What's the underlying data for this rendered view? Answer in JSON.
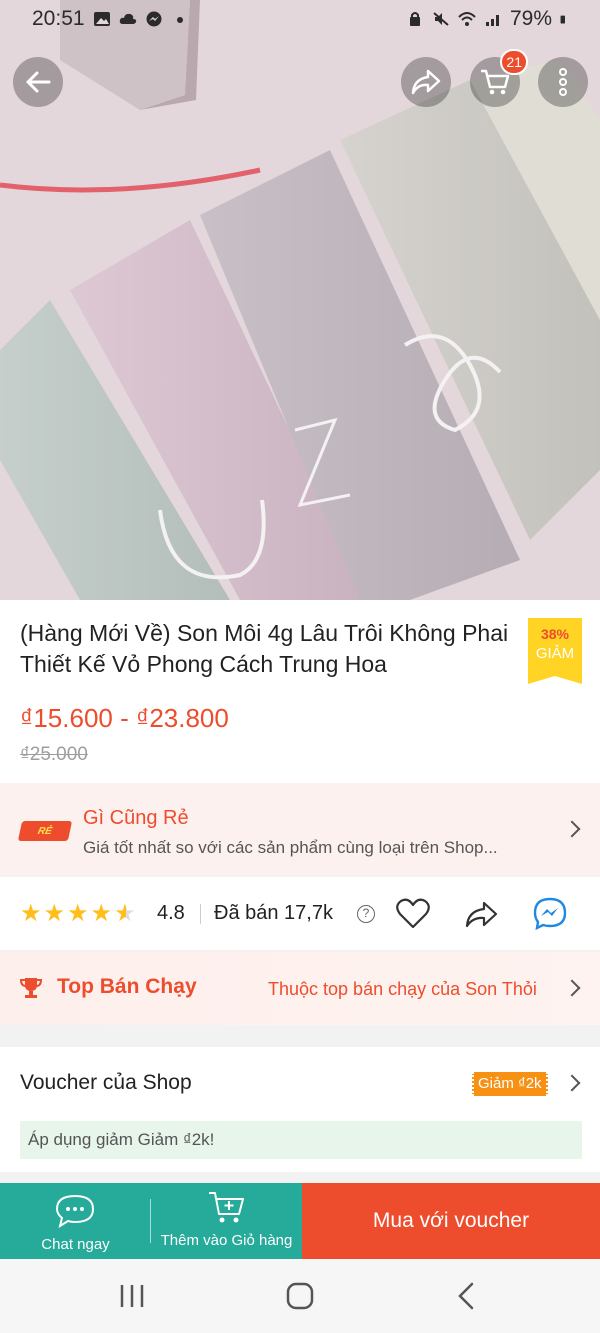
{
  "status_bar": {
    "time": "20:51",
    "battery": "79%"
  },
  "top_bar": {
    "cart_count": "21"
  },
  "product": {
    "title": "(Hàng Mới Về) Son Môi 4g Lâu Trôi Không Phai Thiết Kế Vỏ Phong Cách Trung Hoa",
    "discount_percent": "38%",
    "discount_label": "GIẢM",
    "price_range": "₫15.600 - ₫23.800",
    "original_price": "₫25.000"
  },
  "cheap_banner": {
    "logo_text": "RẺ",
    "title": "Gì Cũng Rẻ",
    "subtitle": "Giá tốt nhất so với các sản phẩm cùng loại trên Shop..."
  },
  "rating": {
    "score": "4.8",
    "stars": 4.5,
    "sold": "Đã bán 17,7k"
  },
  "top_selling": {
    "title": "Top Bán Chạy",
    "subtitle": "Thuộc top bán chạy của Son Thỏi"
  },
  "voucher": {
    "title": "Voucher của Shop",
    "tag": "Giảm ₫2k",
    "note": "Áp dụng giảm Giảm ₫2k!"
  },
  "action_bar": {
    "chat_label": "Chat ngay",
    "cart_label": "Thêm vào Giỏ hàng",
    "buy_label": "Mua với voucher"
  },
  "colors": {
    "accent": "#ee4d2d",
    "teal": "#26aa99",
    "star": "#ffbe1a",
    "badge_yellow": "#ffd424"
  }
}
